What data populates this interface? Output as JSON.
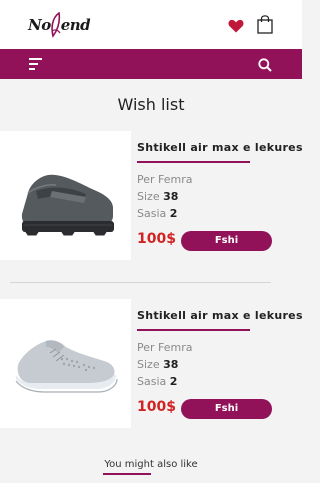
{
  "brand": {
    "logo_left": "No",
    "logo_right": "end"
  },
  "header": {
    "icons": [
      "heart-icon",
      "shopping-bag-icon"
    ]
  },
  "navbar": {
    "icons": [
      "menu-icon",
      "search-icon"
    ],
    "color": "#92125a"
  },
  "page": {
    "title": "Wish list"
  },
  "wishlist": [
    {
      "name": "Shtikell air max e lekures",
      "gender_label": "Per Femra",
      "size_label": "Size",
      "size": "38",
      "qty_label": "Sasia",
      "qty": "2",
      "price": "100$",
      "remove_label": "Fshi",
      "image": "dark-grey-loafer-shoe"
    },
    {
      "name": "Shtikell air max e lekures",
      "gender_label": "Per Femra",
      "size_label": "Size",
      "size": "38",
      "qty_label": "Sasia",
      "qty": "2",
      "price": "100$",
      "remove_label": "Fshi",
      "image": "light-grey-sneaker-shoe"
    }
  ],
  "recommendations": {
    "title": "You might also like"
  },
  "colors": {
    "accent": "#92125a",
    "price": "#d12323",
    "background": "#f3f3f3"
  }
}
